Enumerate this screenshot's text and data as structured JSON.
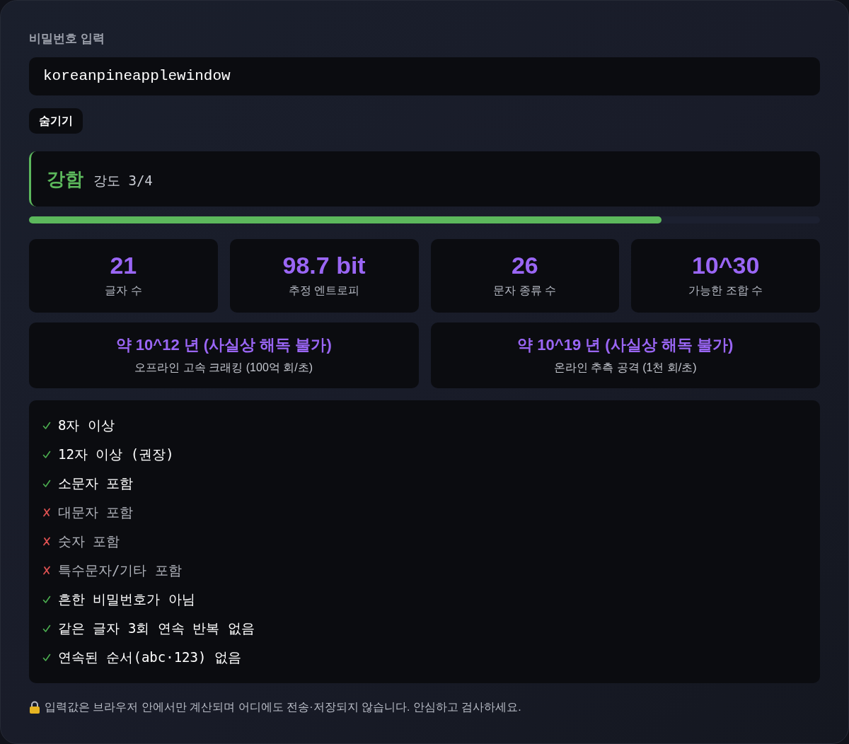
{
  "field": {
    "label": "비밀번호 입력",
    "value": "koreanpineapplewindow"
  },
  "toggle_button": {
    "label": "숨기기"
  },
  "strength": {
    "rating": "강함",
    "score": "강도 3/4",
    "level": 0.8
  },
  "stats": [
    {
      "value": "21",
      "label": "글자 수"
    },
    {
      "value": "98.7 bit",
      "label": "추정 엔트로피"
    },
    {
      "value": "26",
      "label": "문자 종류 수"
    },
    {
      "value": "10^30",
      "label": "가능한 조합 수"
    }
  ],
  "crack_times": [
    {
      "value": "약 10^12 년 (사실상 해독 불가)",
      "label": "오프라인 고속 크래킹 (100억 회/초)"
    },
    {
      "value": "약 10^19 년 (사실상 해독 불가)",
      "label": "온라인 추측 공격 (1천 회/초)"
    }
  ],
  "checks": [
    {
      "label": "8자 이상",
      "passed": true
    },
    {
      "label": "12자 이상 (권장)",
      "passed": true
    },
    {
      "label": "소문자 포함",
      "passed": true
    },
    {
      "label": "대문자 포함",
      "passed": false
    },
    {
      "label": "숫자 포함",
      "passed": false
    },
    {
      "label": "특수문자/기타 포함",
      "passed": false
    },
    {
      "label": "흔한 비밀번호가 아님",
      "passed": true
    },
    {
      "label": "같은 글자 3회 연속 반복 없음",
      "passed": true
    },
    {
      "label": "연속된 순서(abc·123) 없음",
      "passed": true
    }
  ],
  "footer": {
    "note": "입력값은 브라우저 안에서만 계산되며 어디에도 전송·저장되지 않습니다. 안심하고 검사하세요."
  }
}
